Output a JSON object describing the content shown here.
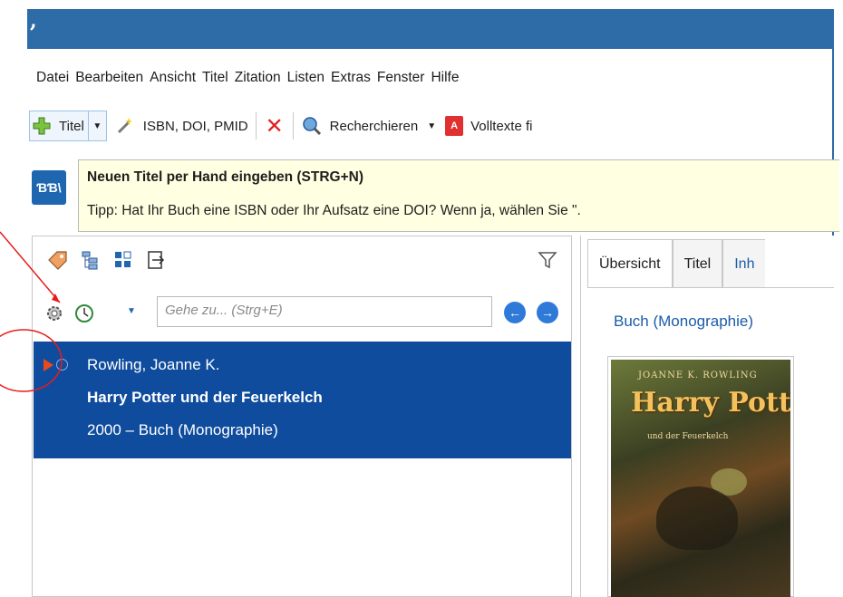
{
  "menu": {
    "items": [
      "Datei",
      "Bearbeiten",
      "Ansicht",
      "Titel",
      "Zitation",
      "Listen",
      "Extras",
      "Fenster",
      "Hilfe"
    ]
  },
  "toolbar": {
    "add_title_label": "Titel",
    "isbn_label": "ISBN, DOI, PMID",
    "research_label": "Recherchieren",
    "fulltext_label": "Volltexte fi"
  },
  "tooltip": {
    "title": "Neuen Titel per Hand eingeben (STRG+N)",
    "body": "Tipp: Hat Ihr Buch eine ISBN oder Ihr Aufsatz eine DOI? Wenn ja, wählen Sie \"."
  },
  "search": {
    "placeholder": "Gehe zu... (Strg+E)"
  },
  "reference": {
    "author": "Rowling, Joanne K.",
    "title": "Harry Potter und der Feuerkelch",
    "meta": "2000 – Buch (Monographie)"
  },
  "detail": {
    "tabs": [
      "Übersicht",
      "Titel",
      "Inh"
    ],
    "type": "Buch (Monographie)"
  },
  "colors": {
    "titlebar": "#2e6ca8",
    "selection": "#0f4c9d",
    "tooltip_bg": "#ffffe1",
    "annotation": "#e81c1c"
  }
}
